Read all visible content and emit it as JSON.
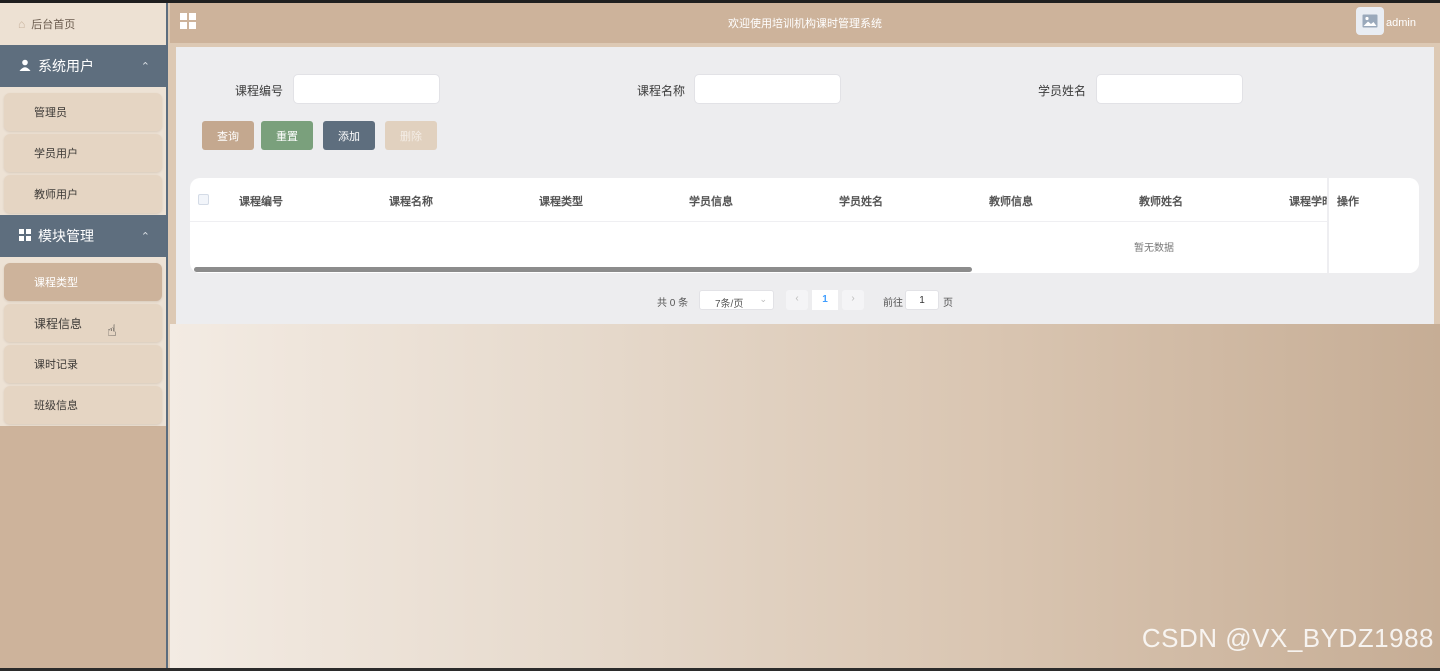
{
  "sidebar": {
    "home_label": "后台首页",
    "groups": [
      {
        "title": "系统用户",
        "items": [
          "管理员",
          "学员用户",
          "教师用户"
        ]
      },
      {
        "title": "模块管理",
        "items": [
          "课程类型",
          "课程信息",
          "课时记录",
          "班级信息"
        ]
      }
    ]
  },
  "header": {
    "title": "欢迎使用培训机构课时管理系统",
    "user": "admin"
  },
  "search": {
    "fields": [
      {
        "label": "课程编号",
        "value": ""
      },
      {
        "label": "课程名称",
        "value": ""
      },
      {
        "label": "学员姓名",
        "value": ""
      }
    ]
  },
  "actions": {
    "query": "查询",
    "reset": "重置",
    "add": "添加",
    "delete": "删除"
  },
  "table": {
    "columns": [
      "课程编号",
      "课程名称",
      "课程类型",
      "学员信息",
      "学员姓名",
      "教师信息",
      "教师姓名",
      "课程学时"
    ],
    "fixed_column": "操作",
    "empty_text": "暂无数据"
  },
  "pagination": {
    "total": "共 0 条",
    "page_size": "7条/页",
    "current_page": "1",
    "goto_label": "前往",
    "goto_value": "1",
    "page_unit": "页"
  },
  "watermark": "CSDN @VX_BYDZ1988",
  "colors": {
    "accent": "#cdb39b",
    "group_header": "#5e6e7e",
    "reset_button": "#7aa07c"
  }
}
